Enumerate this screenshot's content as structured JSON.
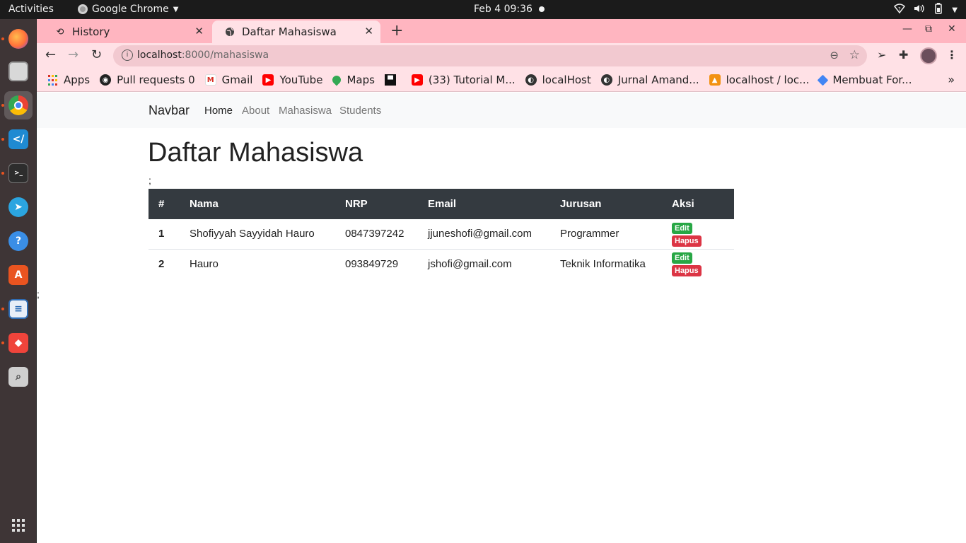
{
  "topbar": {
    "activities": "Activities",
    "app_name": "Google Chrome",
    "clock": "Feb 4  09:36"
  },
  "dock": {
    "items": [
      "firefox-icon",
      "files-icon",
      "chrome-icon",
      "vscode-icon",
      "terminal-icon",
      "telegram-icon",
      "help-icon",
      "software-icon",
      "writer-icon",
      "anydesk-icon",
      "search-icon",
      "app-grid-icon"
    ]
  },
  "chrome": {
    "tabs": [
      {
        "title": "History",
        "icon": "history-icon"
      },
      {
        "title": "Daftar Mahasiswa",
        "icon": "globe-icon"
      }
    ],
    "url_host": "localhost",
    "url_path": ":8000/mahasiswa",
    "bookmarks": [
      {
        "label": "Apps",
        "icon": "apps-grid-icon",
        "color": "#d93025"
      },
      {
        "label": "Pull requests 0",
        "icon": "github-icon",
        "color": "#222222"
      },
      {
        "label": "Gmail",
        "icon": "gmail-icon",
        "color": "#d93025"
      },
      {
        "label": "YouTube",
        "icon": "youtube-icon",
        "color": "#ff0000"
      },
      {
        "label": "Maps",
        "icon": "maps-icon",
        "color": "#34a853"
      },
      {
        "label": "",
        "icon": "unsplash-icon",
        "color": "#111111"
      },
      {
        "label": "(33) Tutorial M...",
        "icon": "youtube-icon",
        "color": "#ff0000"
      },
      {
        "label": "localHost",
        "icon": "globe-icon",
        "color": "#333333"
      },
      {
        "label": "Jurnal Amand...",
        "icon": "globe-icon",
        "color": "#333333"
      },
      {
        "label": "localhost / loc...",
        "icon": "phpmyadmin-icon",
        "color": "#f29111"
      },
      {
        "label": "Membuat For...",
        "icon": "drive-icon",
        "color": "#4285f4"
      }
    ]
  },
  "page": {
    "navbar": {
      "brand": "Navbar",
      "links": [
        "Home",
        "About",
        "Mahasiswa",
        "Students"
      ]
    },
    "title": "Daftar Mahasiswa",
    "semicolon": ";",
    "table": {
      "headers": [
        "#",
        "Nama",
        "NRP",
        "Email",
        "Jurusan",
        "Aksi"
      ],
      "rows": [
        {
          "no": "1",
          "nama": "Shofiyyah Sayyidah Hauro",
          "nrp": "0847397242",
          "email": "jjuneshofi@gmail.com",
          "jurusan": "Programmer"
        },
        {
          "no": "2",
          "nama": "Hauro",
          "nrp": "093849729",
          "email": "jshofi@gmail.com",
          "jurusan": "Teknik Informatika"
        }
      ],
      "edit_label": "Edit",
      "delete_label": "Hapus"
    }
  },
  "colors": {
    "tabstrip": "#ffb5c0",
    "toolbar": "#ffe1e6",
    "table_header": "#343a40",
    "edit": "#28a745",
    "delete": "#dc3545"
  }
}
